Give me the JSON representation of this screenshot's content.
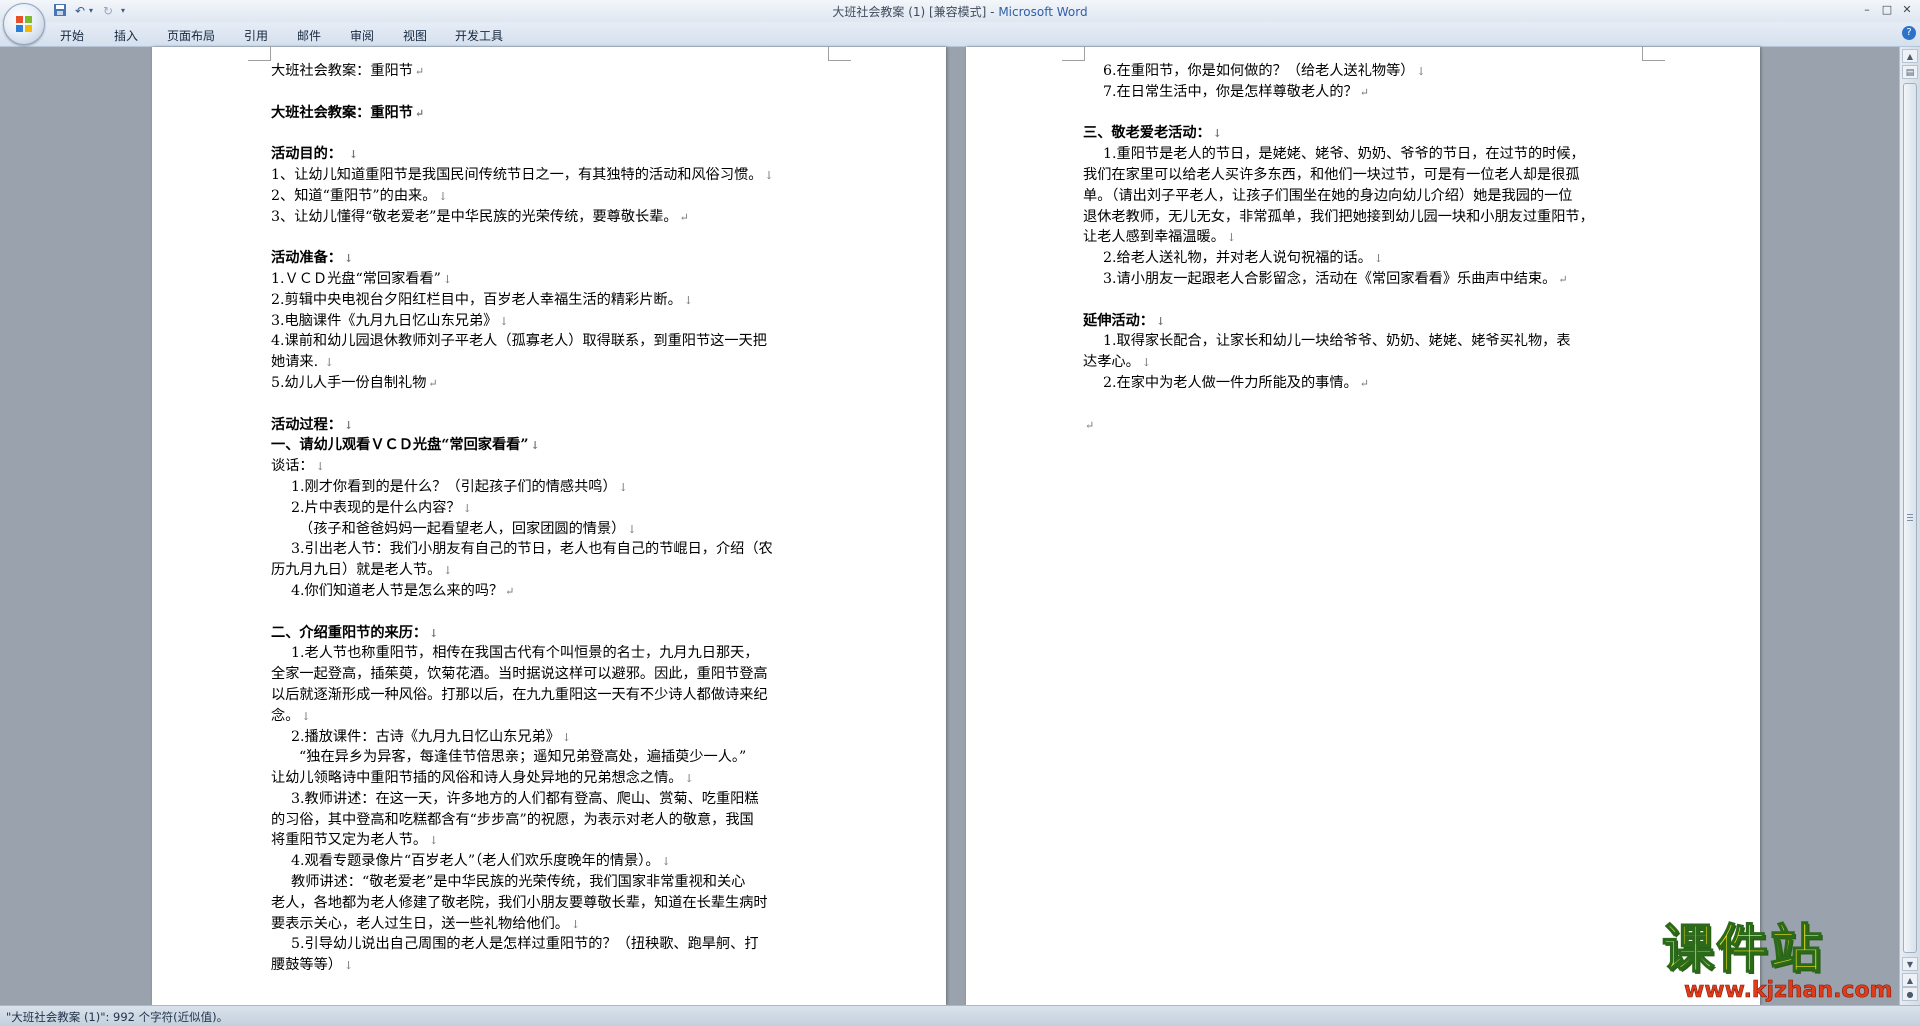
{
  "window": {
    "title": "大班社会教案 (1) [兼容模式] - ",
    "app_name": "Microsoft Word",
    "min_symbol": "–",
    "max_symbol": "□",
    "close_symbol": "✕"
  },
  "ribbon": {
    "tabs": [
      "开始",
      "插入",
      "页面布局",
      "引用",
      "邮件",
      "审阅",
      "视图",
      "开发工具"
    ],
    "help_symbol": "?"
  },
  "document": {
    "page1_lines": [
      {
        "t": "大班社会教案：重阳节",
        "b": false,
        "ind": 0,
        "m": "↵"
      },
      {
        "t": "",
        "b": false,
        "ind": 0,
        "m": ""
      },
      {
        "t": "大班社会教案：重阳节",
        "b": true,
        "ind": 0,
        "m": "↵"
      },
      {
        "t": "",
        "b": false,
        "ind": 0,
        "m": ""
      },
      {
        "t": "活动目的：    ",
        "b": true,
        "ind": 0,
        "m": "↓"
      },
      {
        "t": "1、让幼儿知道重阳节是我国民间传统节日之一，有其独特的活动和风俗习惯。",
        "b": false,
        "ind": 0,
        "m": "↓"
      },
      {
        "t": "2、知道“重阳节”的由来。",
        "b": false,
        "ind": 0,
        "m": "↓"
      },
      {
        "t": "3、让幼儿懂得“敬老爱老”是中华民族的光荣传统，要尊敬长辈。",
        "b": false,
        "ind": 0,
        "m": "↵"
      },
      {
        "t": "",
        "b": false,
        "ind": 0,
        "m": ""
      },
      {
        "t": "活动准备：",
        "b": true,
        "ind": 0,
        "m": "↓"
      },
      {
        "t": "1.ＶＣＤ光盘“常回家看看”",
        "b": false,
        "ind": 0,
        "m": "↓"
      },
      {
        "t": "2.剪辑中央电视台夕阳红栏目中，百岁老人幸福生活的精彩片断。",
        "b": false,
        "ind": 0,
        "m": "↓"
      },
      {
        "t": "3.电脑课件《九月九日忆山东兄弟》",
        "b": false,
        "ind": 0,
        "m": "↓"
      },
      {
        "t": "4.课前和幼儿园退休教师刘子平老人（孤寡老人）取得联系，到重阳节这一天把",
        "b": false,
        "ind": 0,
        "m": ""
      },
      {
        "t": "她请来.  ",
        "b": false,
        "ind": 0,
        "m": "↓"
      },
      {
        "t": "5.幼儿人手一份自制礼物",
        "b": false,
        "ind": 0,
        "m": "↵"
      },
      {
        "t": "",
        "b": false,
        "ind": 0,
        "m": ""
      },
      {
        "t": "活动过程：",
        "b": true,
        "ind": 0,
        "m": "↓"
      },
      {
        "t": "一、请幼儿观看ＶＣＤ光盘“常回家看看”",
        "b": true,
        "ind": 0,
        "m": "↓"
      },
      {
        "t": "谈话：",
        "b": false,
        "ind": 0,
        "m": "↓"
      },
      {
        "t": "1.刚才你看到的是什么？（引起孩子们的情感共鸣）",
        "b": false,
        "ind": 2,
        "m": "↓"
      },
      {
        "t": "2.片中表现的是什么内容？",
        "b": false,
        "ind": 2,
        "m": "↓"
      },
      {
        "t": "（孩子和爸爸妈妈一起看望老人，回家团圆的情景）",
        "b": false,
        "ind": 1,
        "m": "↓"
      },
      {
        "t": "3.引出老人节：我们小朋友有自己的节日，老人也有自己的节崐日，介绍（农",
        "b": false,
        "ind": 2,
        "m": ""
      },
      {
        "t": "历九月九日）就是老人节。",
        "b": false,
        "ind": 0,
        "m": "↓"
      },
      {
        "t": "4.你们知道老人节是怎么来的吗？",
        "b": false,
        "ind": 2,
        "m": "↵"
      },
      {
        "t": "",
        "b": false,
        "ind": 0,
        "m": ""
      },
      {
        "t": "二、介绍重阳节的来历：",
        "b": true,
        "ind": 0,
        "m": "↓"
      },
      {
        "t": "1.老人节也称重阳节，相传在我国古代有个叫恒景的名士，九月九日那天，",
        "b": false,
        "ind": 2,
        "m": ""
      },
      {
        "t": "全家一起登高，插茱萸，饮菊花酒。当时据说这样可以避邪。因此，重阳节登高",
        "b": false,
        "ind": 0,
        "m": ""
      },
      {
        "t": "以后就逐渐形成一种风俗。打那以后，在九九重阳这一天有不少诗人都做诗来纪",
        "b": false,
        "ind": 0,
        "m": ""
      },
      {
        "t": "念。",
        "b": false,
        "ind": 0,
        "m": "↓"
      },
      {
        "t": "2.播放课件：古诗《九月九日忆山东兄弟》",
        "b": false,
        "ind": 2,
        "m": "↓"
      },
      {
        "t": "“独在异乡为异客，每逢佳节倍思亲；遥知兄弟登高处，遍插萸少一人。”",
        "b": false,
        "ind": 1,
        "m": ""
      },
      {
        "t": "让幼儿领略诗中重阳节插的风俗和诗人身处异地的兄弟想念之情。",
        "b": false,
        "ind": 0,
        "m": "↓"
      },
      {
        "t": "3.教师讲述：在这一天，许多地方的人们都有登高、爬山、赏菊、吃重阳糕",
        "b": false,
        "ind": 2,
        "m": ""
      },
      {
        "t": "的习俗，其中登高和吃糕都含有“步步高”的祝愿，为表示对老人的敬意，我国",
        "b": false,
        "ind": 0,
        "m": ""
      },
      {
        "t": "将重阳节又定为老人节。",
        "b": false,
        "ind": 0,
        "m": "↓"
      },
      {
        "t": "4.观看专题录像片“百岁老人”（老人们欢乐度晚年的情景）。",
        "b": false,
        "ind": 2,
        "m": "↓"
      },
      {
        "t": "教师讲述：“敬老爱老”是中华民族的光荣传统，我们国家非常重视和关心",
        "b": false,
        "ind": 2,
        "m": ""
      },
      {
        "t": "老人，各地都为老人修建了敬老院，我们小朋友要尊敬长辈，知道在长辈生病时",
        "b": false,
        "ind": 0,
        "m": ""
      },
      {
        "t": "要表示关心，老人过生日，送一些礼物给他们。",
        "b": false,
        "ind": 0,
        "m": "↓"
      },
      {
        "t": "5.引导幼儿说出自己周围的老人是怎样过重阳节的？（扭秧歌、跑旱舸、打",
        "b": false,
        "ind": 2,
        "m": ""
      },
      {
        "t": "腰鼓等等）",
        "b": false,
        "ind": 0,
        "m": "↓"
      }
    ],
    "page2_lines": [
      {
        "t": "6.在重阳节，你是如何做的？（给老人送礼物等）",
        "b": false,
        "ind": 2,
        "m": "↓"
      },
      {
        "t": "7.在日常生活中，你是怎样尊敬老人的？",
        "b": false,
        "ind": 2,
        "m": "↵"
      },
      {
        "t": "",
        "b": false,
        "ind": 0,
        "m": ""
      },
      {
        "t": "三、敬老爱老活动：",
        "b": true,
        "ind": 0,
        "m": "↓"
      },
      {
        "t": "1.重阳节是老人的节日，是姥姥、姥爷、奶奶、爷爷的节日，在过节的时候，",
        "b": false,
        "ind": 2,
        "m": ""
      },
      {
        "t": "我们在家里可以给老人买许多东西，和他们一块过节，可是有一位老人却是很孤",
        "b": false,
        "ind": 0,
        "m": ""
      },
      {
        "t": "单。（请出刘子平老人，让孩子们围坐在她的身边向幼儿介绍）她是我园的一位",
        "b": false,
        "ind": 0,
        "m": ""
      },
      {
        "t": "退休老教师，无儿无女，非常孤单，我们把她接到幼儿园一块和小朋友过重阳节，",
        "b": false,
        "ind": 0,
        "m": ""
      },
      {
        "t": "让老人感到幸福温暖。",
        "b": false,
        "ind": 0,
        "m": "↓"
      },
      {
        "t": "2.给老人送礼物，并对老人说句祝福的话。",
        "b": false,
        "ind": 2,
        "m": "↓"
      },
      {
        "t": "3.请小朋友一起跟老人合影留念，活动在《常回家看看》乐曲声中结束。",
        "b": false,
        "ind": 2,
        "m": "↵"
      },
      {
        "t": "",
        "b": false,
        "ind": 0,
        "m": ""
      },
      {
        "t": "延伸活动：",
        "b": true,
        "ind": 0,
        "m": "↓"
      },
      {
        "t": "1.取得家长配合，让家长和幼儿一块给爷爷、奶奶、姥姥、姥爷买礼物，表",
        "b": false,
        "ind": 2,
        "m": ""
      },
      {
        "t": "达孝心。",
        "b": false,
        "ind": 0,
        "m": "↓"
      },
      {
        "t": "2.在家中为老人做一件力所能及的事情。",
        "b": false,
        "ind": 2,
        "m": "↵"
      },
      {
        "t": "",
        "b": false,
        "ind": 0,
        "m": ""
      },
      {
        "t": "",
        "b": false,
        "ind": 0,
        "m": "↵"
      }
    ]
  },
  "statusbar": {
    "text": "\"大班社会教案 (1)\": 992 个字符(近似值)。"
  },
  "watermark": {
    "main": "课件站",
    "url": "www.kjzhan.com"
  },
  "colors": {
    "app_name": "#2f5fa8",
    "watermark_main": "#f6e21a",
    "watermark_url": "#e23b1b"
  }
}
